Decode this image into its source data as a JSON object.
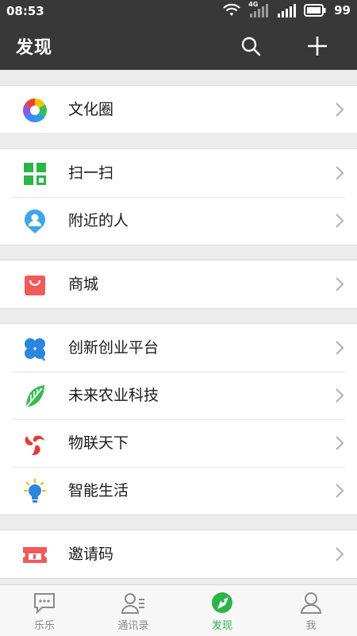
{
  "status_bar": {
    "time": "08:53",
    "network": "4G",
    "battery": "99"
  },
  "header": {
    "title": "发现"
  },
  "groups": [
    {
      "items": [
        {
          "label": "文化圈",
          "icon": "aperture-icon"
        }
      ]
    },
    {
      "items": [
        {
          "label": "扫一扫",
          "icon": "qr-scan-icon"
        },
        {
          "label": "附近的人",
          "icon": "location-person-icon"
        }
      ]
    },
    {
      "items": [
        {
          "label": "商城",
          "icon": "shopping-bag-icon"
        }
      ]
    },
    {
      "items": [
        {
          "label": "创新创业平台",
          "icon": "clover-icon"
        },
        {
          "label": "未来农业科技",
          "icon": "leaf-icon"
        },
        {
          "label": "物联天下",
          "icon": "swirl-icon"
        },
        {
          "label": "智能生活",
          "icon": "lightbulb-icon"
        }
      ]
    },
    {
      "items": [
        {
          "label": "邀请码",
          "icon": "ticket-icon"
        }
      ]
    }
  ],
  "tabs": [
    {
      "label": "乐乐",
      "icon": "chat-bubble-icon"
    },
    {
      "label": "通讯录",
      "icon": "contacts-icon"
    },
    {
      "label": "发现",
      "icon": "compass-icon",
      "active": true
    },
    {
      "label": "我",
      "icon": "person-icon"
    }
  ],
  "colors": {
    "header_bg": "#383838",
    "accent_green": "#2cb34a",
    "page_bg": "#ececec"
  }
}
